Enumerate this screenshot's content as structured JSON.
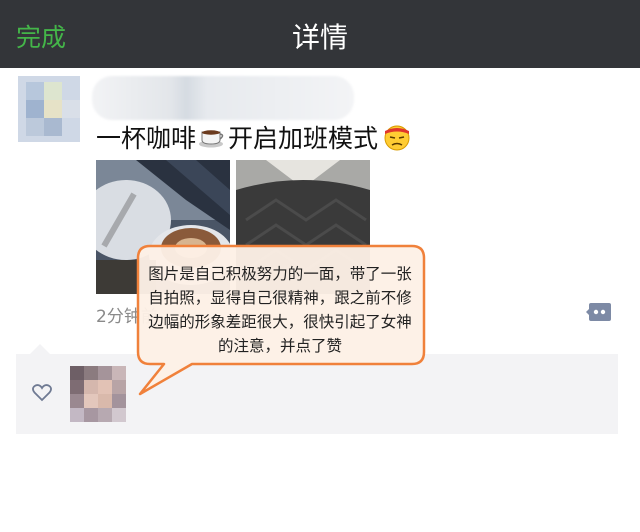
{
  "navbar": {
    "done_label": "完成",
    "title": "详情"
  },
  "post": {
    "text_before": "一杯咖啡",
    "text_after": "开启加班模式",
    "emoji_cup": "coffee-cup-icon",
    "emoji_face": "exhausted-face-icon",
    "timestamp": "2分钟前"
  },
  "annotation": {
    "text": "图片是自己积极努力的一面，带了一张自拍照，显得自己很精神，跟之前不修边幅的形象差距很大，很快引起了女神的注意，并点了赞"
  },
  "colors": {
    "accent": "#44b549",
    "navbar": "#333539",
    "callout_border": "#f0813b",
    "callout_fill": "#fdf0e6"
  }
}
